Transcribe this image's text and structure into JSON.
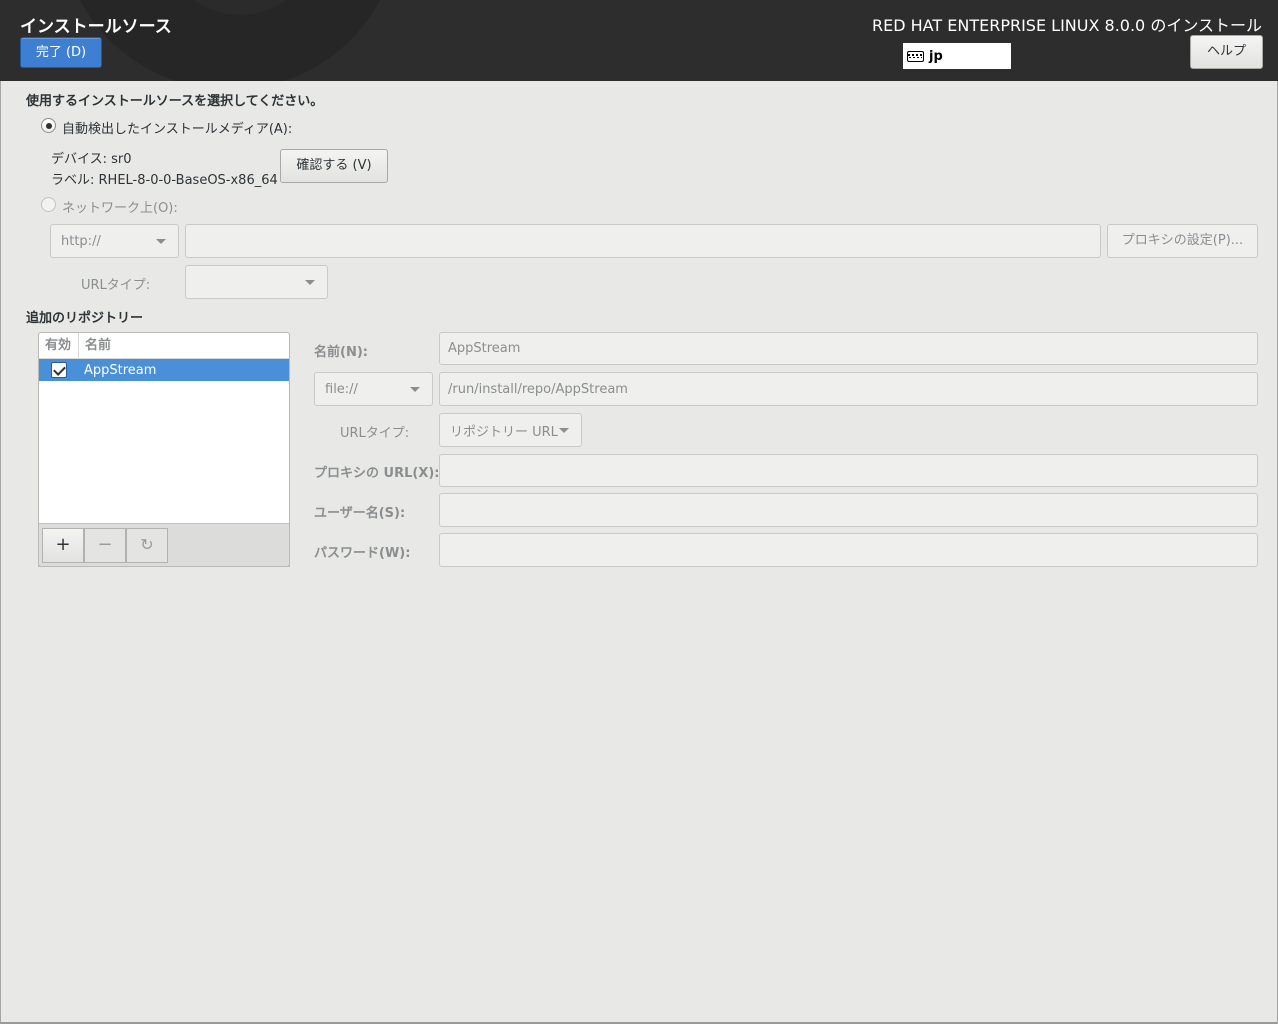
{
  "header": {
    "spoke_title": "インストールソース",
    "done_label": "完了 (D)",
    "product_title": "RED HAT ENTERPRISE LINUX 8.0.0 のインストール",
    "keyboard_layout": "jp",
    "help_label": "ヘルプ"
  },
  "source": {
    "prompt": "使用するインストールソースを選択してください。",
    "auto_media_label": "自動検出したインストールメディア(A):",
    "device_text": "デバイス: sr0",
    "label_text": "ラベル: RHEL-8-0-0-BaseOS-x86_64",
    "verify_label": "確認する (V)",
    "network_label": "ネットワーク上(O):",
    "protocol_value": "http://",
    "url_value": "",
    "proxy_button_label": "プロキシの設定(P)...",
    "url_type_label": "URLタイプ:",
    "url_type_value": ""
  },
  "repos": {
    "section_title": "追加のリポジトリー",
    "col_enabled": "有効",
    "col_name": "名前",
    "items": [
      {
        "enabled": true,
        "name": "AppStream"
      }
    ],
    "add_symbol": "+",
    "remove_symbol": "−",
    "revert_symbol": "↻"
  },
  "repo_detail": {
    "name_label": "名前(N):",
    "name_value": "AppStream",
    "protocol_value": "file://",
    "url_value": "/run/install/repo/AppStream",
    "url_type_label": "URLタイプ:",
    "url_type_value": "リポジトリー URL",
    "proxy_url_label": "プロキシの URL(X):",
    "username_label": "ユーザー名(S):",
    "password_label": "パスワード(W):"
  }
}
